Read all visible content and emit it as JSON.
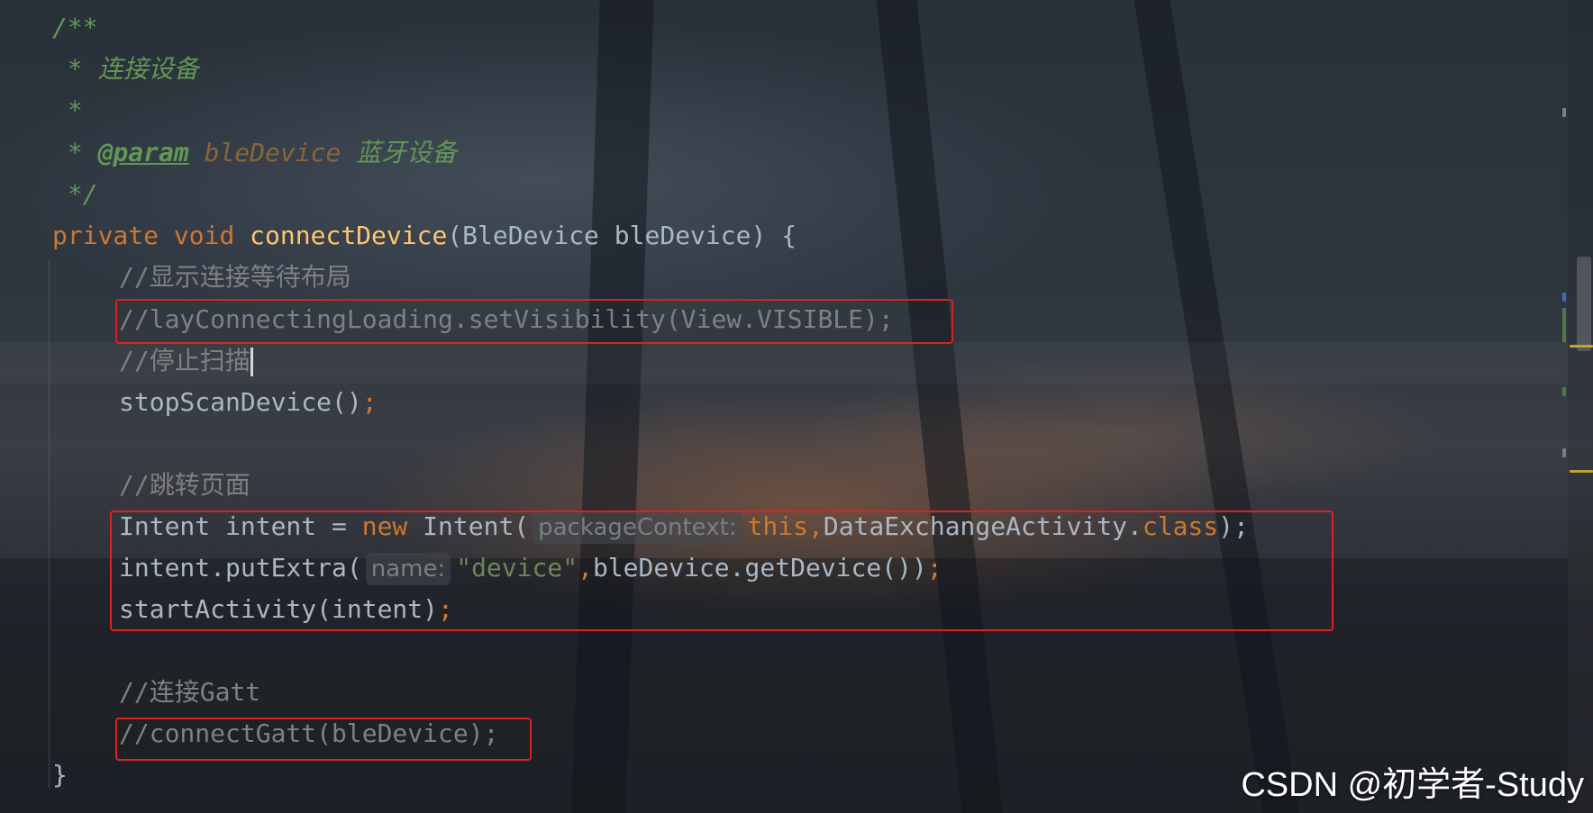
{
  "editor": {
    "lines": {
      "l1": "/**",
      "l2": " * 连接设备",
      "l3": " *",
      "l4_prefix": " * ",
      "l4_tag": "@param",
      "l4_space": " ",
      "l4_param": "bleDevice",
      "l4_desc": " 蓝牙设备",
      "l5": " */",
      "l6_kw1": "private",
      "l6_kw2": "void",
      "l6_fn": "connectDevice",
      "l6_rest": "(BleDevice bleDevice) {",
      "l7": "//显示连接等待布局",
      "l8": "//layConnectingLoading.setVisibility(View.VISIBLE);",
      "l9": "//停止扫描",
      "l10_call": "stopScanDevice()",
      "l10_semi": ";",
      "l11": "//跳转页面",
      "l12_a": "Intent intent = ",
      "l12_new": "new",
      "l12_b": " Intent(",
      "l12_hint": "packageContext:",
      "l12_this": "this,",
      "l12_c": "DataExchangeActivity.",
      "l12_class": "class",
      "l12_d": ");",
      "l13_a": "intent.putExtra(",
      "l13_hint": "name:",
      "l13_str": "\"device\"",
      "l13_comma": ",",
      "l13_b": "bleDevice.getDevice())",
      "l13_semi": ";",
      "l14_a": "startActivity(intent)",
      "l14_semi": ";",
      "l15": "//连接Gatt",
      "l16": "//connectGatt(bleDevice);",
      "l17": "}"
    },
    "colors": {
      "keyword": "#cc7832",
      "function": "#ffc66d",
      "javadoc": "#629755",
      "comment": "#808080",
      "string": "#6a8759",
      "highlight_box": "#e02020"
    }
  },
  "watermark": {
    "text": "CSDN @初学者-Study"
  }
}
